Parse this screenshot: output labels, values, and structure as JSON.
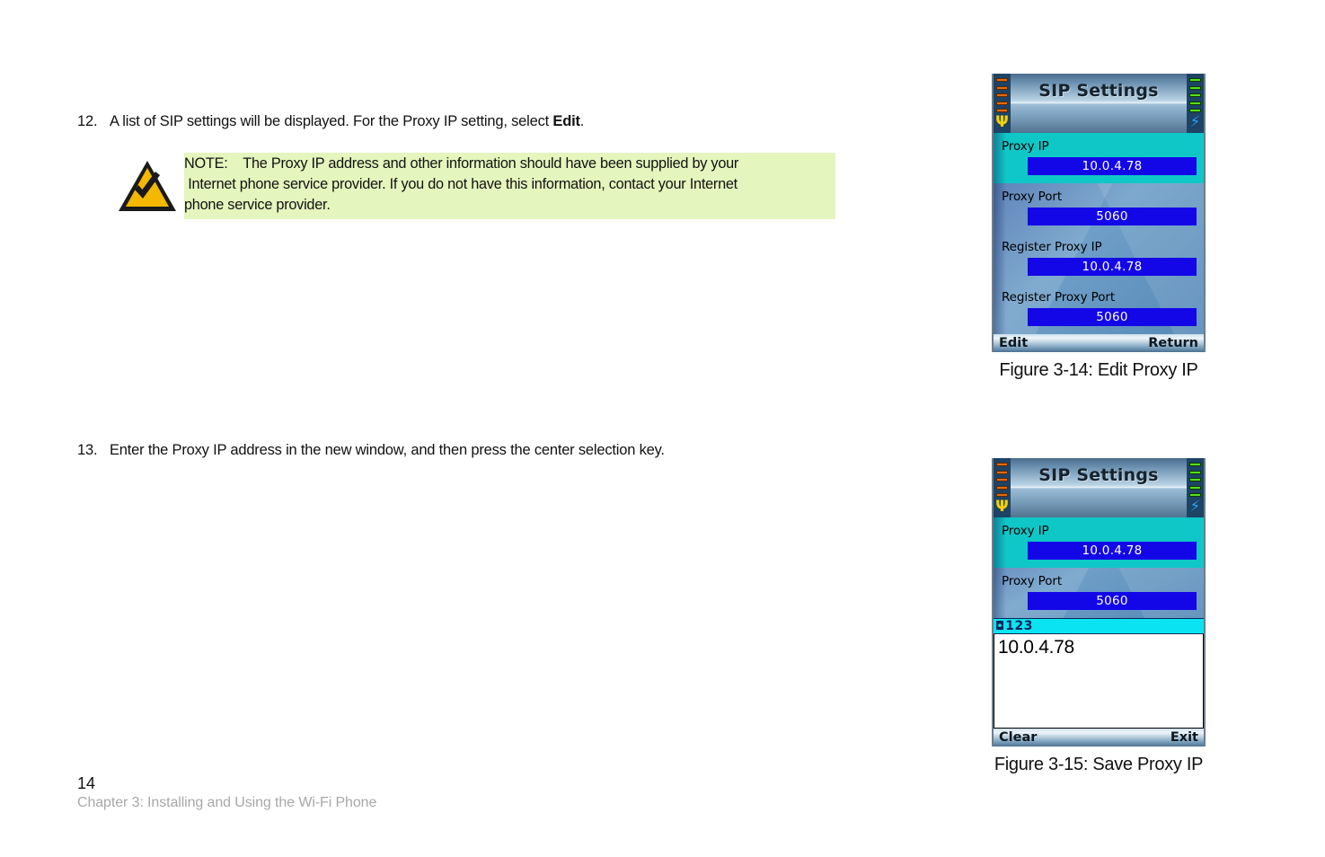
{
  "steps": [
    {
      "number": "12.",
      "text_before": "A list of SIP settings will be displayed. For the Proxy IP setting, select ",
      "emphasis": "Edit",
      "text_after": "."
    },
    {
      "number": "13.",
      "text": "Enter the Proxy IP address in the new window, and then press the center selection key."
    }
  ],
  "note": {
    "icon_name": "note-triangle-check-icon",
    "lines": [
      "NOTE:    The Proxy IP address and other information should have been supplied by your",
      " Internet phone service provider. If you do not have this information, contact your Internet",
      "phone service provider."
    ],
    "highlight_color": "#e4f5bd"
  },
  "figures": [
    {
      "caption": "Figure 3-14: Edit Proxy IP",
      "screen": {
        "title": "SIP Settings",
        "status_left_icon": "signal-strength-icon",
        "status_left_glyph": "Ψ",
        "status_right_icon": "battery-charging-icon",
        "status_right_glyph": "⚡",
        "signal_bars": 5,
        "battery_bars": 5,
        "rows": [
          {
            "label": "Proxy IP",
            "value": "10.0.4.78",
            "selected": true
          },
          {
            "label": "Proxy Port",
            "value": "5060",
            "selected": false
          },
          {
            "label": "Register Proxy IP",
            "value": "10.0.4.78",
            "selected": false
          },
          {
            "label": "Register Proxy Port",
            "value": "5060",
            "selected": false
          }
        ],
        "softkey_left": "Edit",
        "softkey_right": "Return"
      }
    },
    {
      "caption": "Figure 3-15: Save Proxy IP",
      "screen": {
        "title": "SIP Settings",
        "status_left_icon": "signal-strength-icon",
        "status_left_glyph": "Ψ",
        "status_right_icon": "battery-charging-icon",
        "status_right_glyph": "⚡",
        "signal_bars": 5,
        "battery_bars": 5,
        "rows": [
          {
            "label": "Proxy IP",
            "value": "10.0.4.78",
            "selected": true
          },
          {
            "label": "Proxy Port",
            "value": "5060",
            "selected": false
          }
        ],
        "ime_glyph": "◘",
        "ime_mode": "123",
        "editor_value": "10.0.4.78",
        "softkey_left": "Clear",
        "softkey_right": "Exit"
      }
    }
  ],
  "footer": {
    "page_number": "14",
    "chapter": "Chapter 3: Installing and Using the Wi-Fi Phone"
  },
  "colors": {
    "selected_row": "#0fc7c7",
    "value_field": "#1307e8",
    "note_highlight": "#e4f5bd",
    "ime_bar": "#0ae4f2"
  }
}
